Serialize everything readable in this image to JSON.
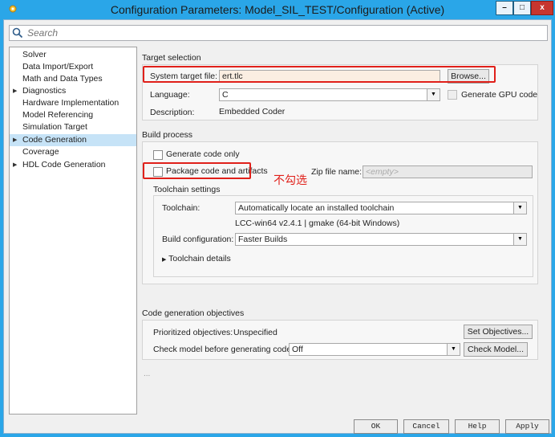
{
  "window": {
    "title": "Configuration Parameters: Model_SIL_TEST/Configuration (Active)",
    "controls": {
      "minimize": "–",
      "maximize": "□",
      "close": "x"
    }
  },
  "search": {
    "placeholder": "Search"
  },
  "tree": {
    "items": [
      {
        "label": "Solver",
        "has_arrow": false,
        "selected": false,
        "indent": 0
      },
      {
        "label": "Data Import/Export",
        "has_arrow": false,
        "selected": false,
        "indent": 0
      },
      {
        "label": "Math and Data Types",
        "has_arrow": false,
        "selected": false,
        "indent": 0
      },
      {
        "label": "Diagnostics",
        "has_arrow": true,
        "selected": false,
        "indent": 0
      },
      {
        "label": "Hardware Implementation",
        "has_arrow": false,
        "selected": false,
        "indent": 0
      },
      {
        "label": "Model Referencing",
        "has_arrow": false,
        "selected": false,
        "indent": 0
      },
      {
        "label": "Simulation Target",
        "has_arrow": false,
        "selected": false,
        "indent": 0
      },
      {
        "label": "Code Generation",
        "has_arrow": true,
        "selected": true,
        "indent": 0
      },
      {
        "label": "Coverage",
        "has_arrow": false,
        "selected": false,
        "indent": 0
      },
      {
        "label": "HDL Code Generation",
        "has_arrow": true,
        "selected": false,
        "indent": 0
      }
    ]
  },
  "target_selection": {
    "title": "Target selection",
    "system_target_file_label": "System target file:",
    "system_target_file_value": "ert.tlc",
    "browse_label": "Browse...",
    "language_label": "Language:",
    "language_value": "C",
    "generate_gpu_label": "Generate GPU code",
    "description_label": "Description:",
    "description_value": "Embedded Coder"
  },
  "build_process": {
    "title": "Build process",
    "generate_code_only_label": "Generate code only",
    "generate_code_only_checked": false,
    "package_label": "Package code and artifacts",
    "package_checked": false,
    "zip_label": "Zip file name:",
    "zip_placeholder": "<empty>",
    "annotation": "不勾选",
    "toolchain_settings_title": "Toolchain settings",
    "toolchain_label": "Toolchain:",
    "toolchain_value": "Automatically locate an installed toolchain",
    "toolchain_info": "LCC-win64 v2.4.1 | gmake (64-bit Windows)",
    "build_config_label": "Build configuration:",
    "build_config_value": "Faster Builds",
    "toolchain_details_label": "Toolchain details"
  },
  "objectives": {
    "title": "Code generation objectives",
    "prioritized_label": "Prioritized objectives:",
    "prioritized_value": "Unspecified",
    "set_objectives_label": "Set Objectives...",
    "check_model_label": "Check model before generating code:",
    "check_model_value": "Off",
    "check_model_button": "Check Model..."
  },
  "ellipsis": "...",
  "footer": {
    "ok": "OK",
    "cancel": "Cancel",
    "help": "Help",
    "apply": "Apply"
  },
  "colors": {
    "title_bar": "#2aa6e8",
    "selection": "#c6e3f7",
    "highlight_red": "#e0201a",
    "field_tint": "#fbeee2"
  }
}
